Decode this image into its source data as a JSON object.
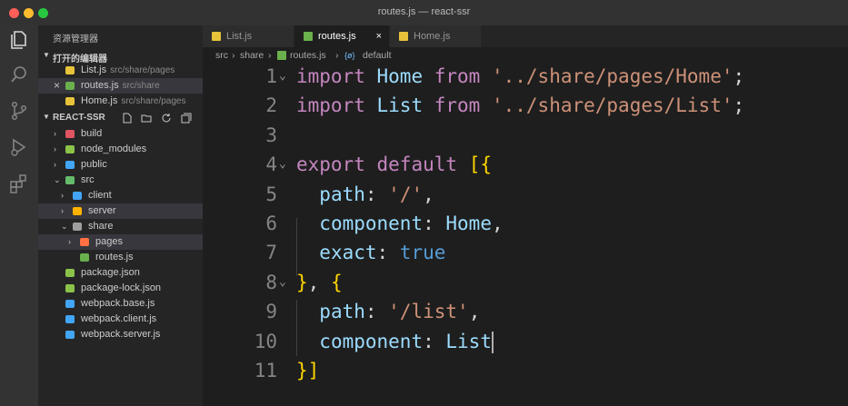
{
  "window": {
    "title": "routes.js — react-ssr"
  },
  "activity_bar": [
    "files-icon",
    "search-icon",
    "source-control-icon",
    "run-debug-icon",
    "extensions-icon"
  ],
  "sidebar": {
    "title": "资源管理器",
    "open_editors": {
      "label": "打开的编辑器",
      "items": [
        {
          "name": "List.js",
          "path": "src/share/pages",
          "icon_color": "#e8c33a"
        },
        {
          "name": "routes.js",
          "path": "src/share",
          "icon_color": "#6ab04c",
          "close": "×"
        },
        {
          "name": "Home.js",
          "path": "src/share/pages",
          "icon_color": "#e8c33a"
        }
      ]
    },
    "project": {
      "label": "REACT-SSR",
      "tree": [
        {
          "name": "build",
          "chevron": "›",
          "icon_color": "#e05561"
        },
        {
          "name": "node_modules",
          "chevron": "›",
          "icon_color": "#8bc34a"
        },
        {
          "name": "public",
          "chevron": "›",
          "icon_color": "#42a5f5"
        },
        {
          "name": "src",
          "chevron": "⌄",
          "icon_color": "#66bb6a"
        },
        {
          "name": "client",
          "chevron": "›",
          "icon_color": "#42a5f5"
        },
        {
          "name": "server",
          "chevron": "›",
          "icon_color": "#ffb300"
        },
        {
          "name": "share",
          "chevron": "⌄",
          "icon_color": "#9e9e9e"
        },
        {
          "name": "pages",
          "chevron": "›",
          "icon_color": "#ff7043"
        },
        {
          "name": "routes.js",
          "chevron": "",
          "icon_color": "#6ab04c"
        },
        {
          "name": "package.json",
          "chevron": "",
          "icon_color": "#8bc34a"
        },
        {
          "name": "package-lock.json",
          "chevron": "",
          "icon_color": "#8bc34a"
        },
        {
          "name": "webpack.base.js",
          "chevron": "",
          "icon_color": "#42a5f5"
        },
        {
          "name": "webpack.client.js",
          "chevron": "",
          "icon_color": "#42a5f5"
        },
        {
          "name": "webpack.server.js",
          "chevron": "",
          "icon_color": "#42a5f5"
        }
      ]
    }
  },
  "tabs": [
    {
      "name": "List.js",
      "icon_color": "#e8c33a",
      "active": false
    },
    {
      "name": "routes.js",
      "icon_color": "#6ab04c",
      "active": true,
      "close": "×"
    },
    {
      "name": "Home.js",
      "icon_color": "#e8c33a",
      "active": false
    }
  ],
  "breadcrumb": [
    "src",
    "share",
    "routes.js",
    "default"
  ],
  "code": {
    "line_numbers": [
      "1",
      "2",
      "3",
      "4",
      "5",
      "6",
      "7",
      "8",
      "9",
      "10",
      "11"
    ],
    "lines": [
      [
        [
          "kw",
          "import"
        ],
        [
          "pn",
          " "
        ],
        [
          "id",
          "Home"
        ],
        [
          "pn",
          " "
        ],
        [
          "kw",
          "from"
        ],
        [
          "pn",
          " "
        ],
        [
          "st",
          "'../share/pages/Home'"
        ],
        [
          "pn",
          ";"
        ]
      ],
      [
        [
          "kw",
          "import"
        ],
        [
          "pn",
          " "
        ],
        [
          "id",
          "List"
        ],
        [
          "pn",
          " "
        ],
        [
          "kw",
          "from"
        ],
        [
          "pn",
          " "
        ],
        [
          "st",
          "'../share/pages/List'"
        ],
        [
          "pn",
          ";"
        ]
      ],
      [],
      [
        [
          "kw",
          "export"
        ],
        [
          "pn",
          " "
        ],
        [
          "kw",
          "default"
        ],
        [
          "pn",
          " "
        ],
        [
          "br",
          "["
        ],
        [
          "pr",
          "{"
        ]
      ],
      [
        [
          "pn",
          "  "
        ],
        [
          "id",
          "path"
        ],
        [
          "pn",
          ": "
        ],
        [
          "st",
          "'/'"
        ],
        [
          "pn",
          ","
        ]
      ],
      [
        [
          "pn",
          "  "
        ],
        [
          "id",
          "component"
        ],
        [
          "pn",
          ": "
        ],
        [
          "id",
          "Home"
        ],
        [
          "pn",
          ","
        ]
      ],
      [
        [
          "pn",
          "  "
        ],
        [
          "id",
          "exact"
        ],
        [
          "pn",
          ": "
        ],
        [
          "bl",
          "true"
        ]
      ],
      [
        [
          "pr",
          "}"
        ],
        [
          "pn",
          ", "
        ],
        [
          "pr",
          "{"
        ]
      ],
      [
        [
          "pn",
          "  "
        ],
        [
          "id",
          "path"
        ],
        [
          "pn",
          ": "
        ],
        [
          "st",
          "'/list'"
        ],
        [
          "pn",
          ","
        ]
      ],
      [
        [
          "pn",
          "  "
        ],
        [
          "id",
          "component"
        ],
        [
          "pn",
          ": "
        ],
        [
          "id",
          "List"
        ]
      ],
      [
        [
          "pr",
          "}"
        ],
        [
          "br",
          "]"
        ]
      ]
    ]
  }
}
